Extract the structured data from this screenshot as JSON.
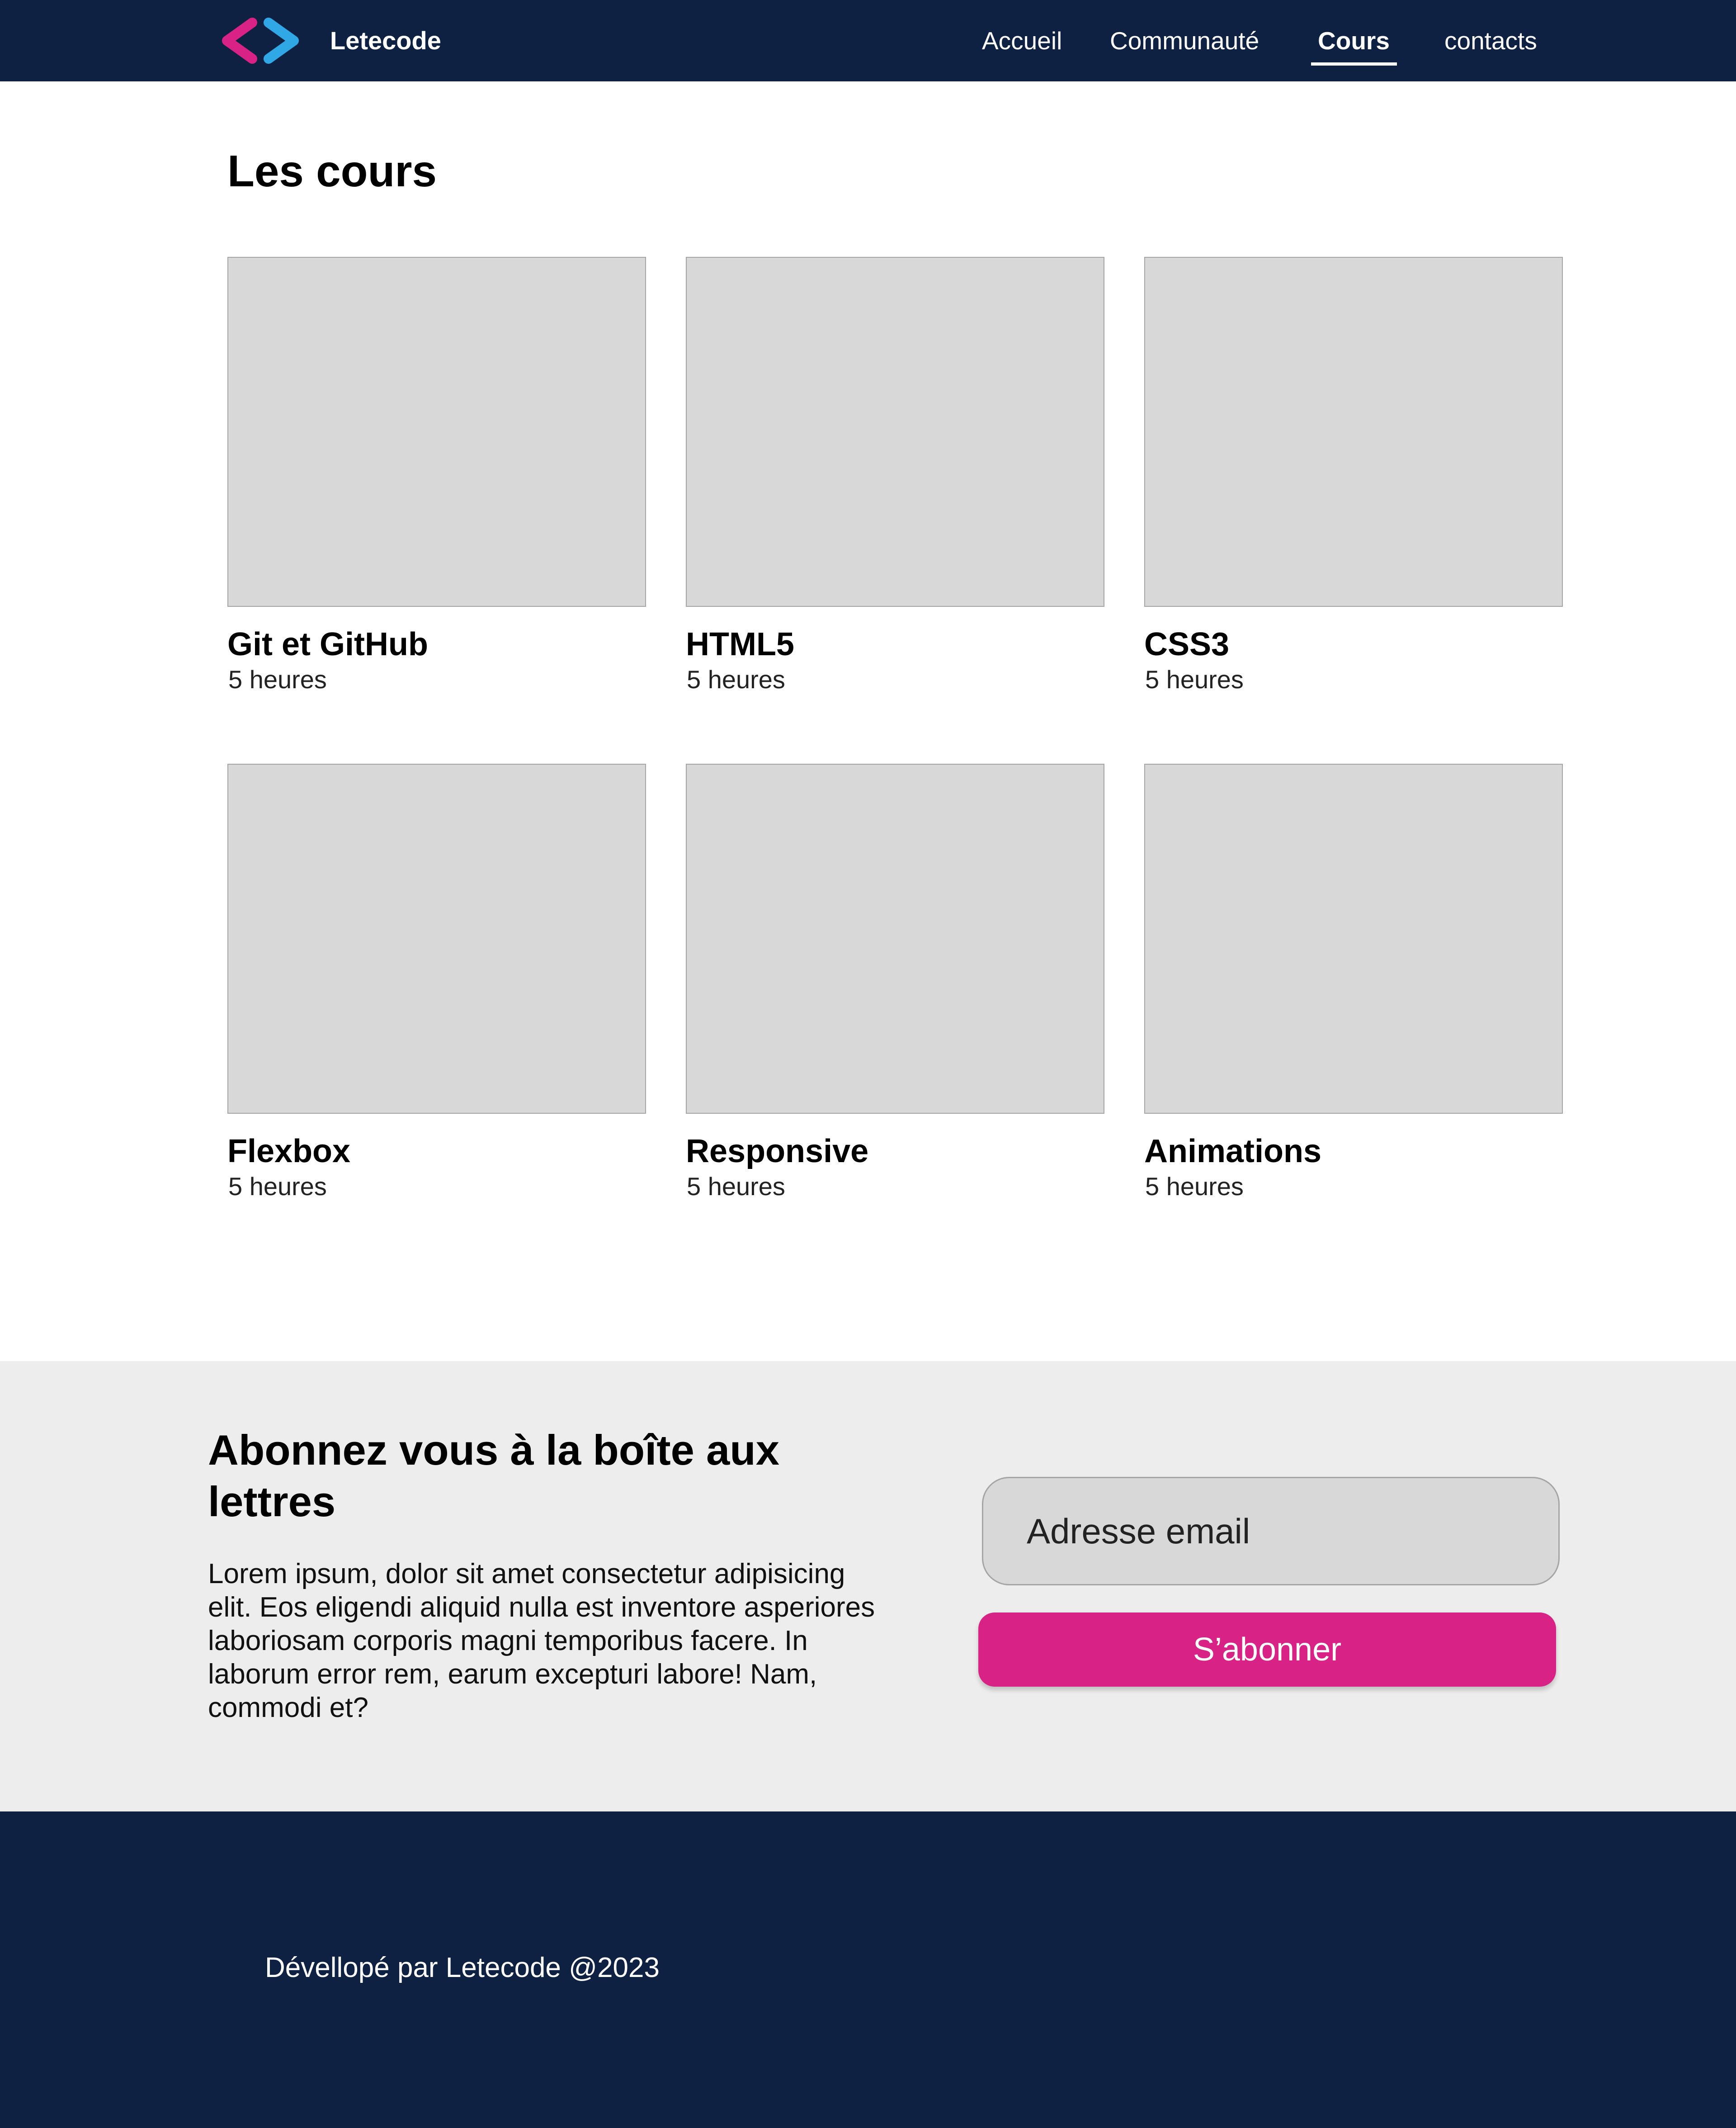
{
  "header": {
    "brand": "Letecode",
    "logo_colors": {
      "left": "#d92286",
      "right": "#2fa8e5"
    },
    "nav": {
      "accueil": "Accueil",
      "communaute": "Communauté",
      "cours": "Cours",
      "contacts": "contacts"
    },
    "active_nav": "Cours"
  },
  "courses": {
    "title": "Les cours",
    "items": [
      {
        "name": "Git et GitHub",
        "duration": "5 heures"
      },
      {
        "name": "HTML5",
        "duration": "5 heures"
      },
      {
        "name": "CSS3",
        "duration": "5 heures"
      },
      {
        "name": "Flexbox",
        "duration": "5 heures"
      },
      {
        "name": "Responsive",
        "duration": "5 heures"
      },
      {
        "name": "Animations",
        "duration": "5 heures"
      }
    ]
  },
  "newsletter": {
    "title": "Abonnez vous à la boîte aux lettres",
    "text": "Lorem ipsum, dolor sit amet consectetur adipisicing elit. Eos eligendi aliquid nulla est inventore asperiores laboriosam corporis magni temporibus facere. In laborum error rem, earum excepturi labore! Nam, commodi et?",
    "email_placeholder": "Adresse email",
    "email_value": "",
    "subscribe_label": "S’abonner"
  },
  "footer": {
    "text": "Dévellopé par Letecode @2023"
  },
  "colors": {
    "navy": "#0f2143",
    "accent_pink": "#d92286",
    "placeholder_gray": "#d8d8d8",
    "newsletter_bg": "#ededed"
  }
}
